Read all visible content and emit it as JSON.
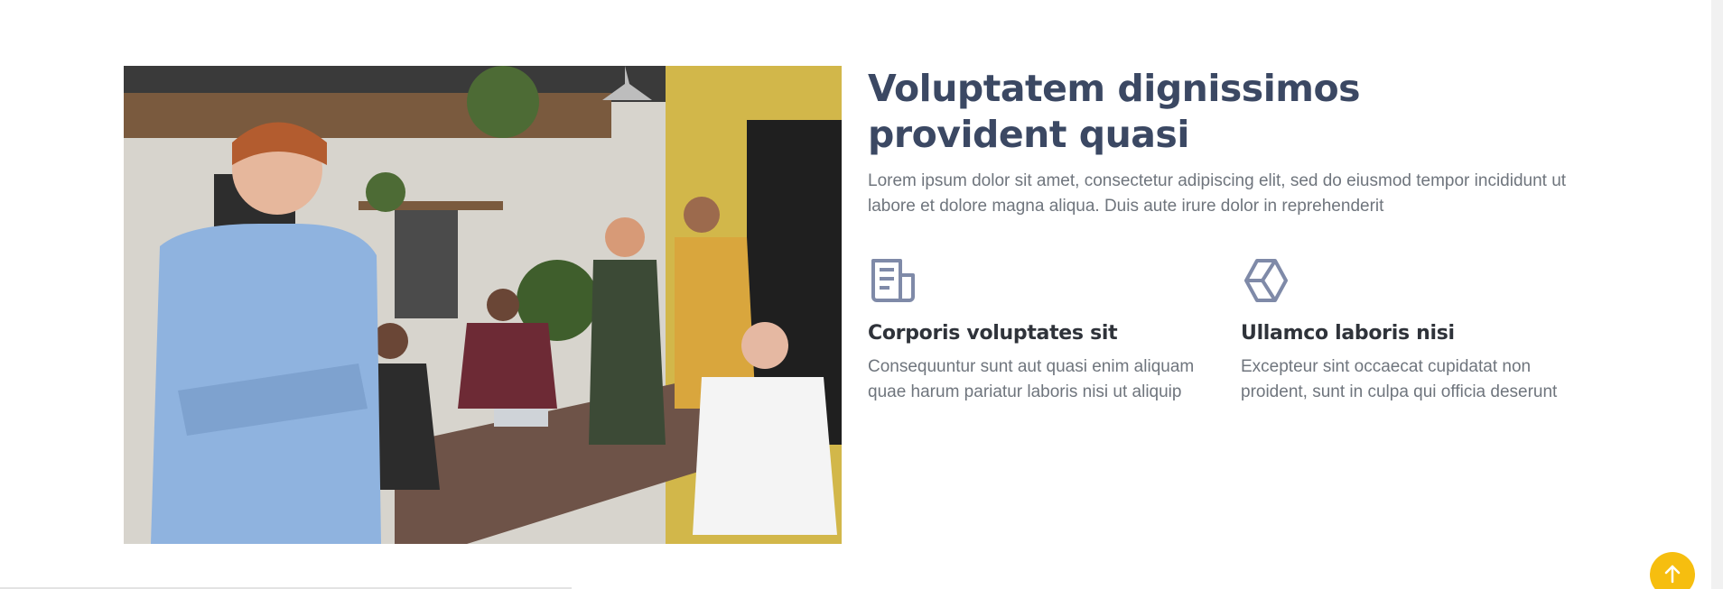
{
  "hero_image": {
    "alt_description": "",
    "colors": {
      "wall": "#d9d6cf",
      "yellow_wall": "#d6bb4a",
      "table": "#6e5348",
      "shirt_blue": "#8fb3df"
    }
  },
  "content": {
    "title": "Voluptatem dignissimos provident quasi",
    "lead": "Lorem ipsum dolor sit amet, consectetur adipiscing elit, sed do eiusmod tempor incididunt ut labore et dolore magna aliqua. Duis aute irure dolor in reprehenderit",
    "features": [
      {
        "icon": "newspaper-icon",
        "title": "Corporis voluptates sit",
        "description": "Consequuntur sunt aut quasi enim aliquam quae harum pariatur laboris nisi ut aliquip"
      },
      {
        "icon": "cube-icon",
        "title": "Ullamco laboris nisi",
        "description": "Excepteur sint occaecat cupidatat non proident, sunt in culpa qui officia deserunt"
      }
    ]
  },
  "back_to_top": {
    "icon": "arrow-up-icon",
    "color": "#f6be0f"
  },
  "colors": {
    "title": "#3b4863",
    "text": "#6f757d",
    "feature_title": "#2f333a",
    "icon": "#7f8aa8"
  }
}
